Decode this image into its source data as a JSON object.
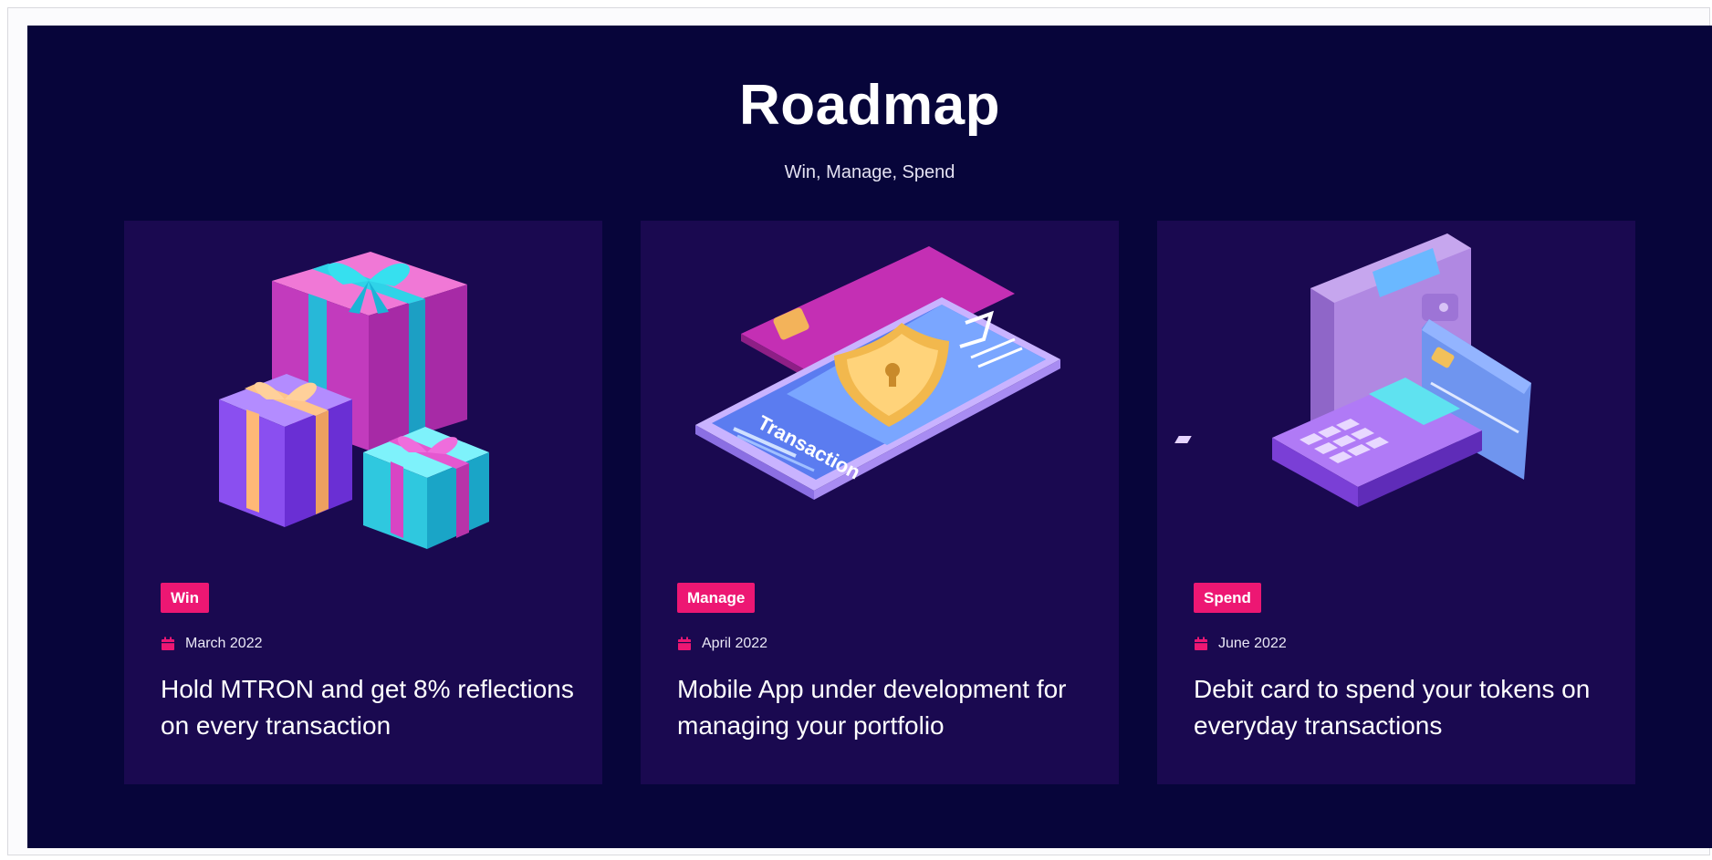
{
  "header": {
    "title": "Roadmap",
    "subtitle": "Win, Manage, Spend"
  },
  "cards": [
    {
      "badge": "Win",
      "date": "March 2022",
      "text": "Hold MTRON and get 8% reflections on every transaction",
      "illustration": "gift-boxes-illustration"
    },
    {
      "badge": "Manage",
      "date": "April 2022",
      "text": "Mobile App under development for managing your portfolio",
      "illustration": "phone-transaction-illustration",
      "illustration_text": "Transaction"
    },
    {
      "badge": "Spend",
      "date": "June 2022",
      "text": "Debit card to spend your tokens on everyday transactions",
      "illustration": "wallet-card-calculator-illustration"
    }
  ],
  "colors": {
    "background": "#07053a",
    "card": "#1a0950",
    "badge": "#ed1773",
    "text": "#ffffff"
  }
}
